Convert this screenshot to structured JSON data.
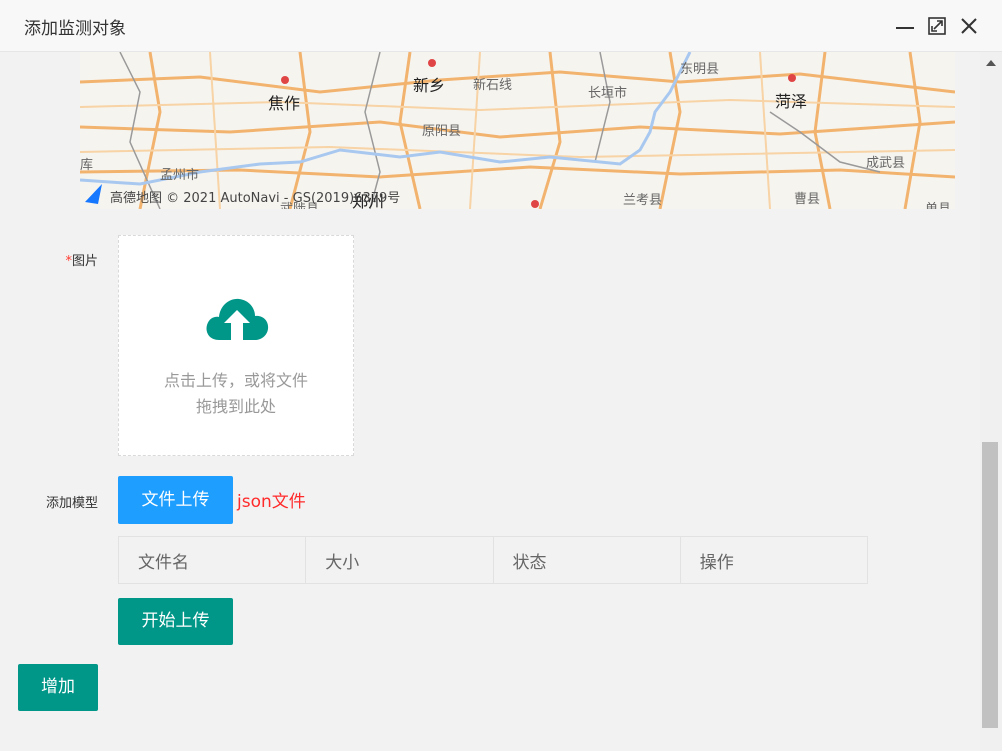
{
  "window": {
    "title": "添加监测对象",
    "controls": [
      "minimize-icon",
      "maximize-icon",
      "close-icon"
    ]
  },
  "map": {
    "credit": "高德地图 © 2021 AutoNavi - GS(2019)6379号",
    "places": [
      "新乡",
      "新石线",
      "东明县",
      "菏泽",
      "焦作",
      "长垣市",
      "原阳县",
      "成武县",
      "孟州市",
      "郑州",
      "兰考县",
      "曹县",
      "单县",
      "武陟县",
      "库"
    ]
  },
  "form": {
    "image_label": "图片",
    "image_required_mark": "*",
    "upload_text_line1": "点击上传，或将文件",
    "upload_text_line2": "拖拽到此处",
    "model_label": "添加模型",
    "file_upload_button": "文件上传",
    "json_note": "json文件",
    "table_headers": [
      "文件名",
      "大小",
      "状态",
      "操作"
    ],
    "start_upload_button": "开始上传",
    "add_button": "增加"
  },
  "colors": {
    "primary_blue": "#1e9fff",
    "primary_green": "#009688",
    "required_red": "#ff3b30",
    "note_red": "#ff2a2a"
  }
}
